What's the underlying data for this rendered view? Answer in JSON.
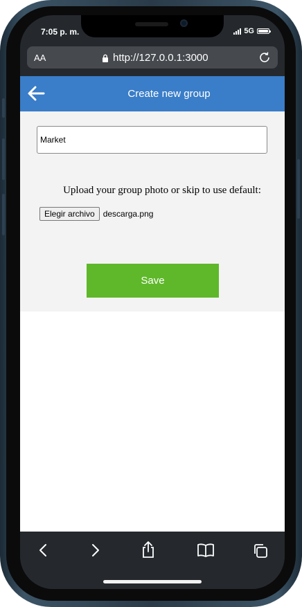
{
  "status": {
    "time": "7:05 p. m.",
    "network": "5G"
  },
  "browser": {
    "text_size_label": "AA",
    "url": "http://127.0.0.1:3000"
  },
  "header": {
    "title": "Create new group"
  },
  "form": {
    "group_name_value": "Market",
    "upload_text": "Upload your group photo or skip to use default:",
    "choose_file_label": "Elegir archivo",
    "chosen_file_name": "descarga.png",
    "save_label": "Save"
  },
  "colors": {
    "header_bg": "#3a7dc8",
    "save_bg": "#5fb82a",
    "form_bg": "#f3f3f3"
  },
  "toolbar_icons": [
    "back-icon",
    "forward-icon",
    "share-icon",
    "bookmarks-icon",
    "tabs-icon"
  ]
}
